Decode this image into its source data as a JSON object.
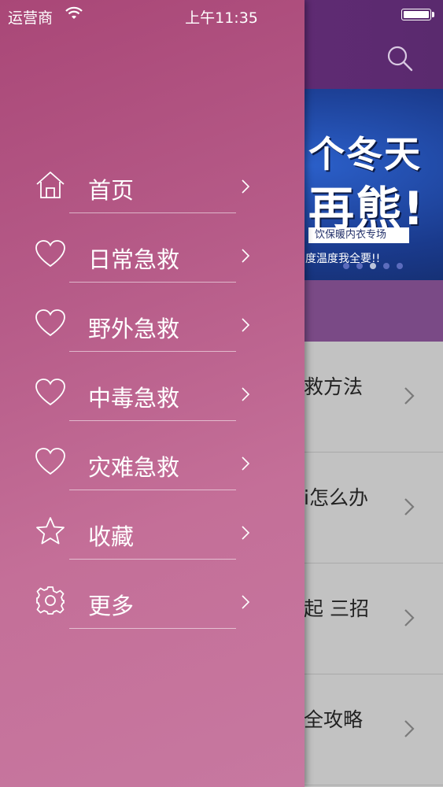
{
  "status_bar": {
    "carrier": "运营商",
    "time": "上午11:35"
  },
  "banner": {
    "line1": "个冬天",
    "line2": "再熊!",
    "tag": "饮保暖内衣专场",
    "small": "度温度我全要!!",
    "page_count": 5,
    "active_page": 2
  },
  "list": [
    {
      "text": "救方法"
    },
    {
      "text": "i怎么办"
    },
    {
      "text": "起 三招"
    },
    {
      "text": "全攻略"
    }
  ],
  "menu": [
    {
      "label": "首页",
      "icon": "home-icon"
    },
    {
      "label": "日常急救",
      "icon": "heart-icon"
    },
    {
      "label": "野外急救",
      "icon": "heart-icon"
    },
    {
      "label": "中毒急救",
      "icon": "heart-icon"
    },
    {
      "label": "灾难急救",
      "icon": "heart-icon"
    },
    {
      "label": "收藏",
      "icon": "star-icon"
    },
    {
      "label": "更多",
      "icon": "gear-icon"
    }
  ],
  "colors": {
    "drawer_top": "#a94777",
    "drawer_bottom": "#c778a0",
    "header": "#6a2d7e",
    "banner": "#1a3a8c"
  }
}
